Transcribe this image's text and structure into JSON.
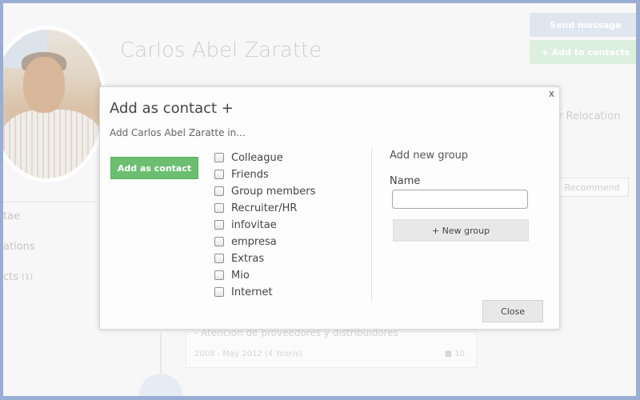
{
  "background": {
    "profile_name": "Carlos Abel Zaratte",
    "send_message_label": "Send message",
    "add_to_contacts_label": "+ Add to contacts",
    "relocation_text": "or Relocation",
    "recommend_label": "Recommend",
    "menu": [
      {
        "label": "tae",
        "count": ""
      },
      {
        "label": "ations",
        "count": ""
      },
      {
        "label": "cts",
        "count": "(1)"
      }
    ],
    "card": {
      "title": "- Atención de proveedores y distribuidores",
      "dates": "2008 - May 2012 (4 Year/s)",
      "comments": "10"
    }
  },
  "modal": {
    "close_x": "x",
    "title": "Add as contact +",
    "subtitle": "Add Carlos Abel Zaratte in...",
    "add_button_label": "Add as contact",
    "groups": [
      {
        "label": "Colleague",
        "checked": false
      },
      {
        "label": "Friends",
        "checked": false
      },
      {
        "label": "Group members",
        "checked": false
      },
      {
        "label": "Recruiter/HR",
        "checked": false
      },
      {
        "label": "infovitae",
        "checked": false
      },
      {
        "label": "empresa",
        "checked": false
      },
      {
        "label": "Extras",
        "checked": false
      },
      {
        "label": "Mio",
        "checked": false
      },
      {
        "label": "Internet",
        "checked": false
      }
    ],
    "new_group_title": "Add new group",
    "name_label": "Name",
    "name_value": "",
    "new_group_button_label": "+ New group",
    "close_button_label": "Close"
  },
  "colors": {
    "accent_green": "#6cbf71",
    "frame_blue": "#9aaed4"
  }
}
